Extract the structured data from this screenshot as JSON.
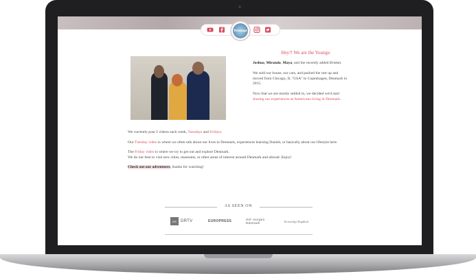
{
  "header": {
    "logo_text": "Youngs",
    "social_icons": [
      "youtube-icon",
      "facebook-icon",
      "instagram-icon",
      "twitter-icon"
    ],
    "accent_color": "#d84a5c"
  },
  "intro": {
    "heading": "Hey!! We are the Youngs:",
    "names_line": {
      "name1": "Joshua",
      "sep1": ", ",
      "name2": "Miranda",
      "sep2": ", ",
      "name3": "Maya",
      "rest": ", and the recently added Brisket."
    },
    "para2": "We sold our house, our cars, and packed the rest up and moved from Chicago, IL \"USA\" to Copenhagen, Denmark in 2015.",
    "para3_start": "Now that we are mostly settled in, we decided we'd start ",
    "para3_link": "sharing our experiences as Americans living in Denmark",
    "para3_end": "."
  },
  "schedule": {
    "p1_start": "We currently post 2 videos each week, ",
    "p1_day1": "Tuesdays",
    "p1_mid": " and ",
    "p1_day2": "Fridays",
    "p1_end": ".",
    "p2_start": "Our ",
    "p2_link": "Tuesday video",
    "p2_end": " is where we often talk about our lives in Denmark, experiences learning Danish, or basically about our lifestyle here.",
    "p3_start": "The ",
    "p3_link": "Friday video",
    "p3_end": " is where we try to get out and explore Denmark.",
    "p3_line2": "We do our best to visit new cities, museums, or other areas of interest around Denmark and abroad. Enjoy!",
    "p4_link": "Check out our adventures",
    "p4_end": ", thanks for watching!"
  },
  "as_seen_on": {
    "title": "AS SEEN ON",
    "outlets": [
      {
        "badge": "DR",
        "name": "DRTV"
      },
      {
        "name": "EUROPRESS"
      },
      {
        "name": "GO' morgen Danmark"
      },
      {
        "name": "Kristeligt Dagblad"
      }
    ]
  }
}
